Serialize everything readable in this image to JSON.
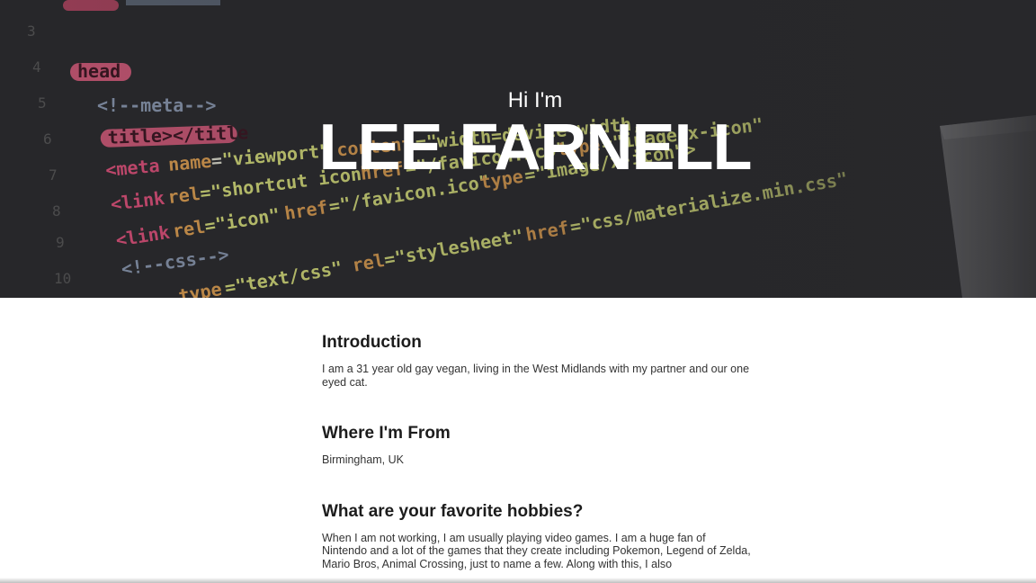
{
  "hero": {
    "greeting": "Hi I'm",
    "name": "LEE FARNELL",
    "code_lines": [
      "<head>",
      "<!--meta-->",
      "<title></title>",
      "<meta name=\"viewport\" content=\"width=device-width,",
      "<link rel=\"shortcut icon\" href=\"/favicon.ico\" type=\"image/x-icon\">",
      "<link rel=\"icon\" href=\"/favicon.ico\" type=\"image/x-icon\">",
      "<!--css-->",
      "type=\"text/css\" rel=\"stylesheet\" href=\"css/materialize.min.css\" media=\"screen,projection\""
    ]
  },
  "sections": [
    {
      "title": "Introduction",
      "body": "I am a 31 year old gay vegan, living in the West Midlands with my partner and our one eyed cat."
    },
    {
      "title": "Where I'm From",
      "body": "Birmingham, UK"
    },
    {
      "title": "What are your favorite hobbies?",
      "body": "When I am not working, I am usually playing video games. I am a huge fan of Nintendo and a lot of the games that they create including Pokemon, Legend of Zelda, Mario Bros, Animal Crossing, just to name a few. Along with this, I also"
    }
  ]
}
